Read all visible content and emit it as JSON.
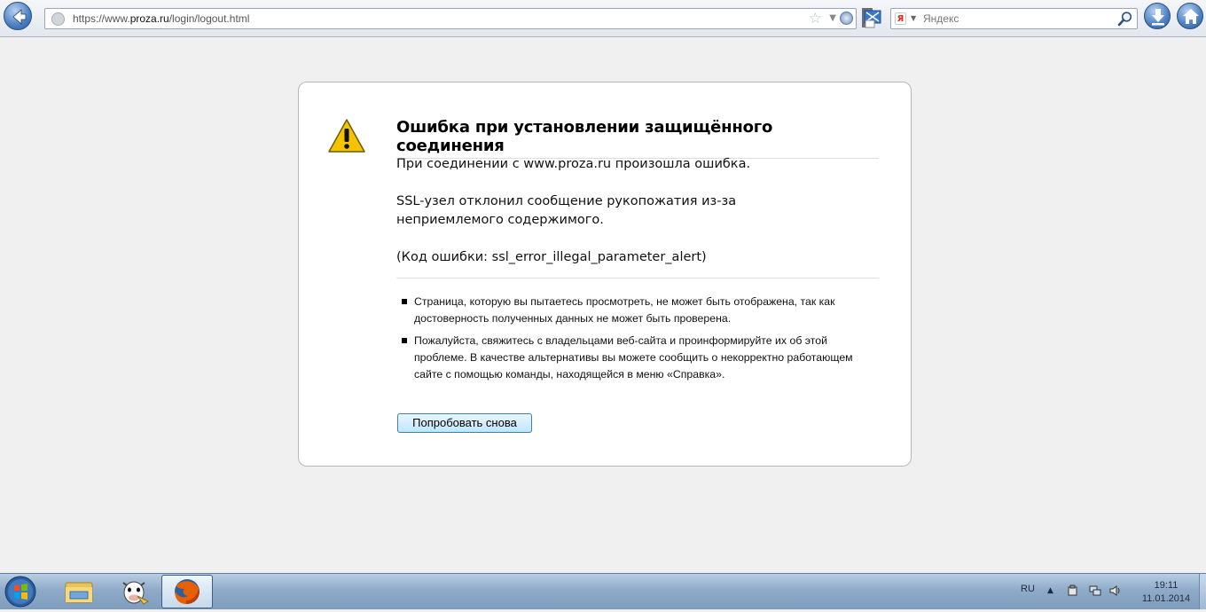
{
  "browser": {
    "url_prefix": "https://www.",
    "url_domain": "proza.ru",
    "url_path": "/login/logout.html",
    "search_placeholder": "Яндекс",
    "search_engine_glyph": "Я"
  },
  "error": {
    "title": "Ошибка при установлении защищённого соединения",
    "line1": "При соединении с www.proza.ru произошла ошибка.",
    "line2": "SSL-узел отклонил сообщение рукопожатия из-за неприемлемого содержимого.",
    "line3": "(Код ошибки: ssl_error_illegal_parameter_alert)",
    "bullets": [
      "Страница, которую вы пытаетесь просмотреть, не может быть отображена, так как достоверность полученных данных не может быть проверена.",
      "Пожалуйста, свяжитесь с владельцами веб-сайта и проинформируйте их об этой проблеме. В качестве альтернативы вы можете сообщить о некорректно работающем сайте с помощью команды, находящейся в меню «Справка»."
    ],
    "retry_label": "Попробовать снова"
  },
  "taskbar": {
    "language": "RU",
    "time": "19:11",
    "date": "11.01.2014"
  },
  "icons": {
    "back": "back-arrow-icon",
    "globe": "globe-icon",
    "star": "star-icon",
    "reload": "reload-icon",
    "search": "magnifier-icon",
    "download": "download-icon",
    "home": "home-icon",
    "warning": "warning-icon"
  }
}
